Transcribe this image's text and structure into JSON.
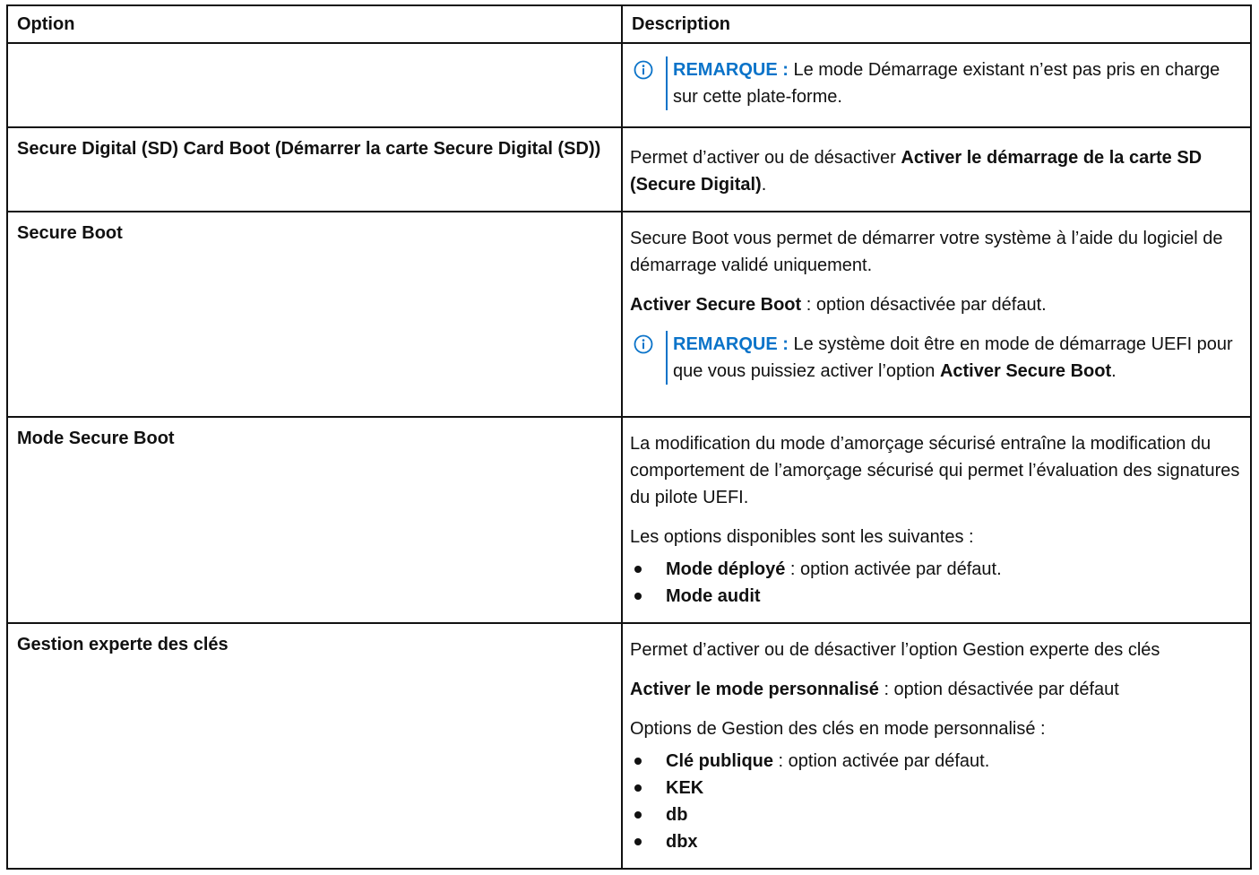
{
  "table": {
    "header": {
      "option": "Option",
      "description": "Description"
    },
    "note_label": "REMARQUE :",
    "rows": [
      {
        "option": "",
        "note_text": "Le mode Démarrage existant n’est pas pris en charge sur cette plate-forme."
      },
      {
        "option": "Secure Digital (SD) Card Boot (Démarrer la carte Secure Digital (SD))",
        "desc_prefix": "Permet d’activer ou de désactiver ",
        "desc_bold": "Activer le démarrage de la carte SD (Secure Digital)",
        "desc_suffix": "."
      },
      {
        "option": "Secure Boot",
        "p1": "Secure Boot vous permet de démarrer votre système à l’aide du logiciel de démarrage validé uniquement.",
        "p2_bold": "Activer Secure Boot",
        "p2_rest": " : option désactivée par défaut.",
        "note_text": "Le système doit être en mode de démarrage UEFI pour que vous puissiez activer l’option ",
        "note_bold": "Activer Secure Boot",
        "note_suffix": "."
      },
      {
        "option": "Mode Secure Boot",
        "p1": "La modification du mode d’amorçage sécurisé entraîne la modification du comportement de l’amorçage sécurisé qui permet l’évaluation des signatures du pilote UEFI.",
        "p2": "Les options disponibles sont les suivantes :",
        "items": [
          {
            "bold": "Mode déployé",
            "rest": " : option activée par défaut."
          },
          {
            "bold": "Mode audit",
            "rest": ""
          }
        ]
      },
      {
        "option": "Gestion experte des clés",
        "p1": "Permet d’activer ou de désactiver l’option Gestion experte des clés",
        "p2_bold": "Activer le mode personnalisé",
        "p2_rest": " : option désactivée par défaut",
        "p3": "Options de Gestion des clés en mode personnalisé :",
        "items": [
          {
            "bold": "Clé publique",
            "rest": " : option activée par défaut."
          },
          {
            "bold": "KEK",
            "rest": ""
          },
          {
            "bold": "db",
            "rest": ""
          },
          {
            "bold": "dbx",
            "rest": ""
          }
        ]
      }
    ]
  },
  "icons": {
    "note": "info-circle-icon"
  },
  "colors": {
    "note_accent": "#0a73c9",
    "text": "#111111",
    "border": "#111111"
  }
}
